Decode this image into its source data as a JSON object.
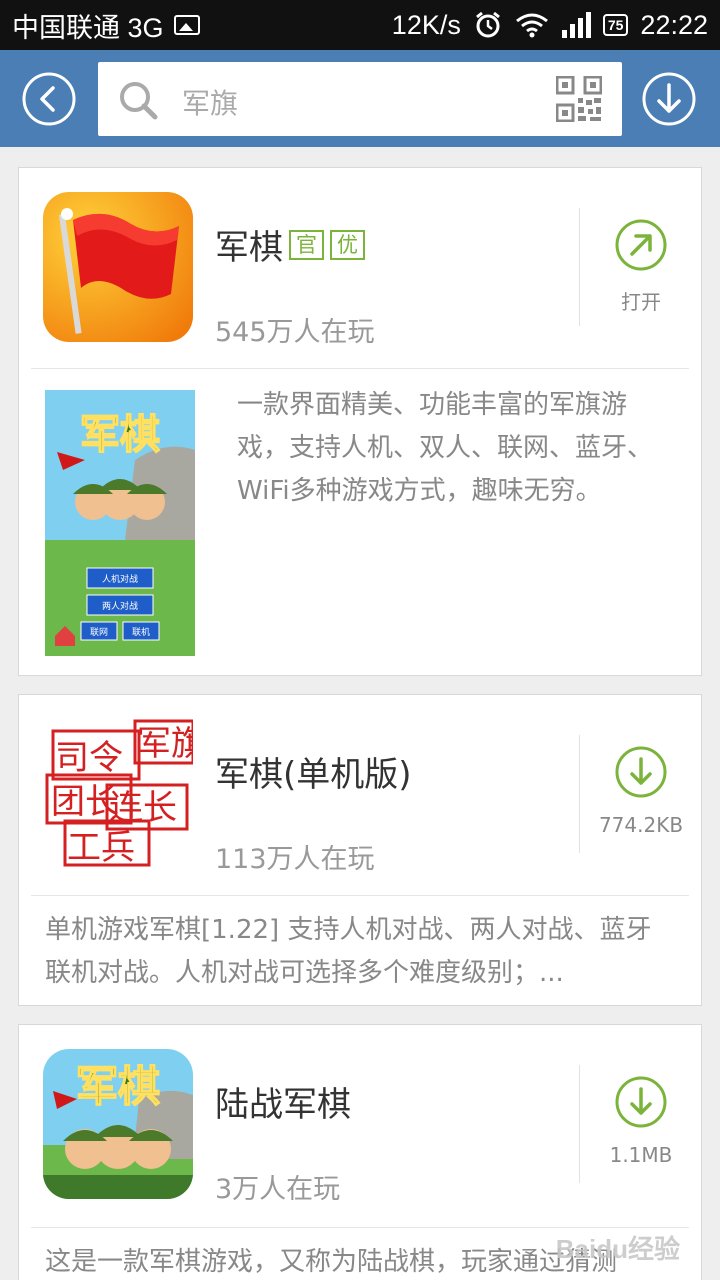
{
  "status_bar": {
    "carrier": "中国联通 3G",
    "net_speed": "12K/s",
    "battery": "75",
    "time": "22:22",
    "icons": [
      "image-icon",
      "alarm-icon",
      "wifi-icon",
      "signal-icon",
      "battery-icon"
    ]
  },
  "header": {
    "search_text": "军旗",
    "colors": {
      "bar": "#4a7eb5"
    }
  },
  "apps": [
    {
      "name": "军棋",
      "badges": [
        "官",
        "优"
      ],
      "players": "545万人在玩",
      "action_label": "打开",
      "action_icon": "open-arrow-icon",
      "description": "一款界面精美、功能丰富的军旗游戏，支持人机、双人、联网、蓝牙、WiFi多种游戏方式，趣味无穷。",
      "screenshot": {
        "title": "军棋",
        "buttons": [
          "人机对战",
          "两人对战",
          "联网",
          "联机"
        ]
      }
    },
    {
      "name": "军棋(单机版)",
      "players": "113万人在玩",
      "action_label": "774.2KB",
      "action_icon": "download-icon",
      "icon_text": [
        "司令",
        "军旗",
        "团长",
        "连长",
        "工兵"
      ],
      "description": "单机游戏军棋[1.22] 支持人机对战、两人对战、蓝牙联机对战。人机对战可选择多个难度级别；..."
    },
    {
      "name": "陆战军棋",
      "players": "3万人在玩",
      "action_label": "1.1MB",
      "action_icon": "download-icon",
      "icon_text": "军棋",
      "description": "这是一款军棋游戏，又称为陆战棋，玩家通过猜测"
    }
  ],
  "watermark": "Baidu经验",
  "colors": {
    "accent_green": "#7cb33b",
    "text_gray": "#888888"
  }
}
